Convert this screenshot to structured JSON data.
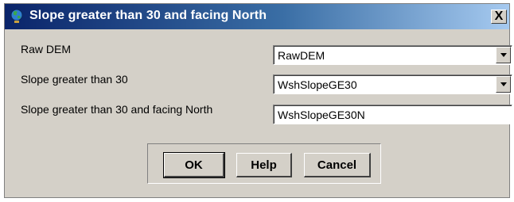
{
  "window": {
    "title": "Slope greater than 30 and facing North",
    "close_label": "X"
  },
  "form": {
    "fields": [
      {
        "label": "Raw DEM",
        "value": "RawDEM",
        "type": "combo"
      },
      {
        "label": "Slope greater than 30",
        "value": "WshSlopeGE30",
        "type": "combo"
      },
      {
        "label": "Slope greater than 30 and facing North",
        "value": "WshSlopeGE30N",
        "type": "text"
      }
    ]
  },
  "buttons": {
    "ok": "OK",
    "help": "Help",
    "cancel": "Cancel"
  }
}
